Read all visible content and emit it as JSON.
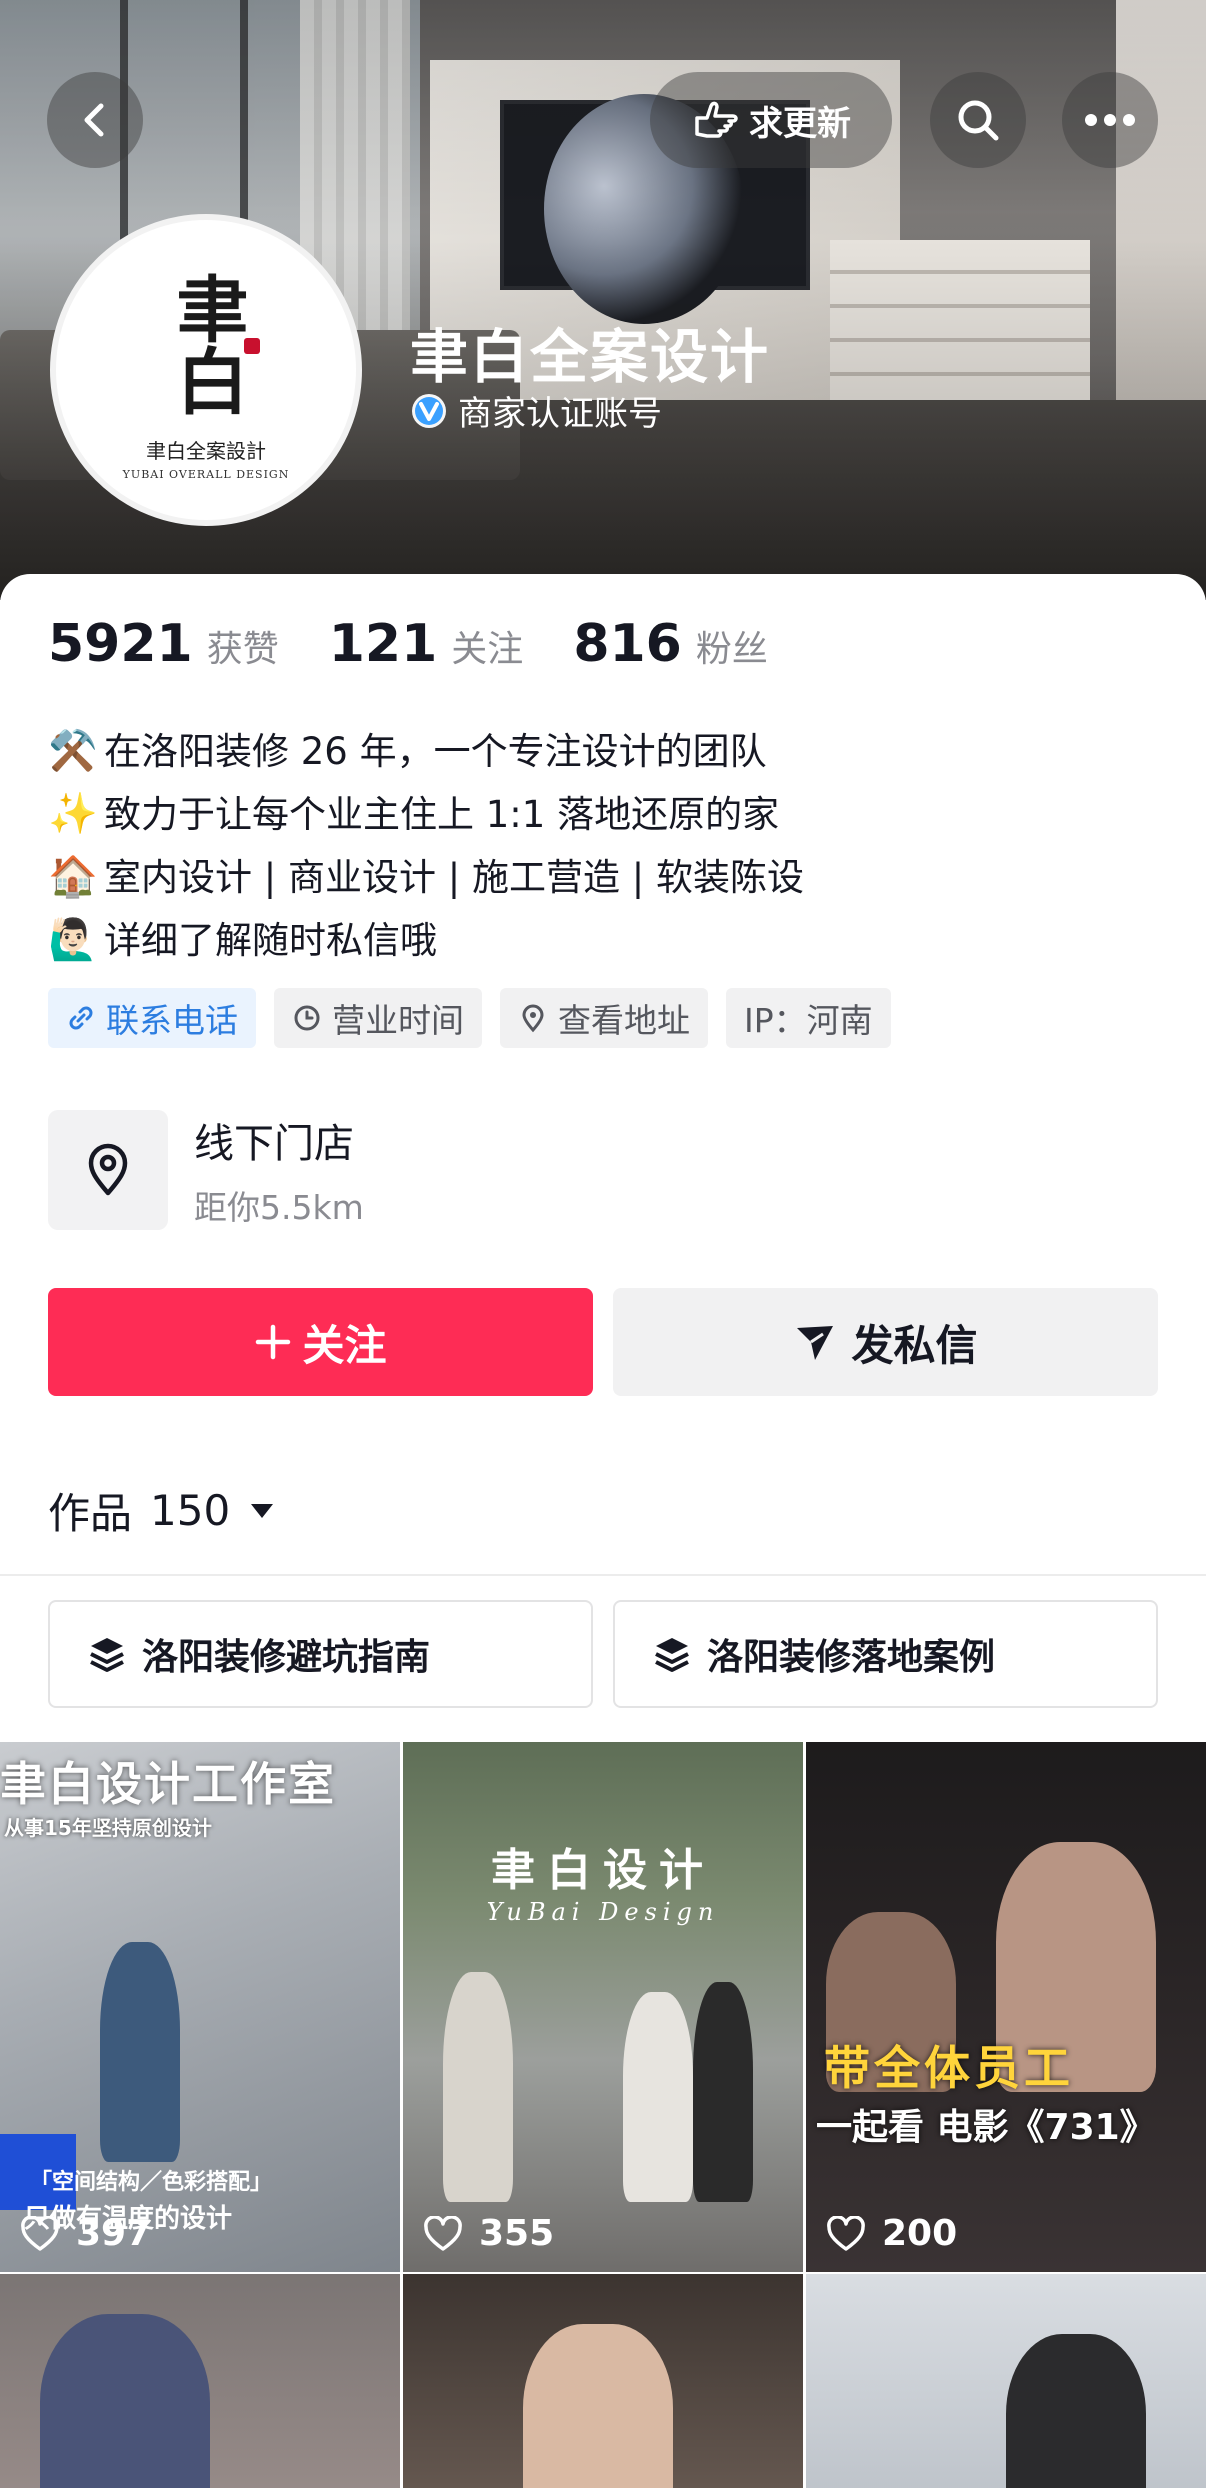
{
  "header": {
    "request_update_label": "求更新"
  },
  "profile": {
    "name": "聿白全案设计",
    "verified_label": "商家认证账号",
    "avatar_logo": "聿白",
    "avatar_sub": "聿白全案設計",
    "avatar_en": "YUBAI OVERALL DESIGN"
  },
  "stats": [
    {
      "value": "5921",
      "label": "获赞"
    },
    {
      "value": "121",
      "label": "关注"
    },
    {
      "value": "816",
      "label": "粉丝"
    }
  ],
  "bio": [
    {
      "emoji": "⚒️",
      "text": "在洛阳装修 26 年，一个专注设计的团队"
    },
    {
      "emoji": "✨",
      "text": "致力于让每个业主住上 1:1 落地还原的家"
    },
    {
      "emoji": "🏠",
      "text": "室内设计 | 商业设计 | 施工营造 | 软装陈设"
    },
    {
      "emoji": "🙋🏻‍♂️",
      "text": "详细了解随时私信哦"
    }
  ],
  "tags": {
    "phone": "联系电话",
    "hours": "营业时间",
    "address": "查看地址",
    "ip": "IP：河南"
  },
  "store": {
    "title": "线下门店",
    "distance": "距你5.5km"
  },
  "actions": {
    "follow": "关注",
    "message": "发私信"
  },
  "works": {
    "label": "作品",
    "count": "150"
  },
  "collections": [
    "洛阳装修避坑指南",
    "洛阳装修落地案例"
  ],
  "videos": [
    {
      "likes": "397",
      "title": "聿白设计工作室",
      "subtitle": "从事15年坚持原创设计",
      "caption1": "「空间结构／色彩搭配」",
      "caption2": "只做有温度的设计"
    },
    {
      "likes": "355",
      "title": "聿白设计",
      "subtitle": "YuBai Design"
    },
    {
      "likes": "200",
      "title1": "带全体员工",
      "title2": "一起看 电影《731》"
    },
    {},
    {},
    {}
  ],
  "colors": {
    "follow_button": "#fe2c55",
    "verified_blue": "#2c7de0",
    "title_yellow": "#ffd43b"
  }
}
